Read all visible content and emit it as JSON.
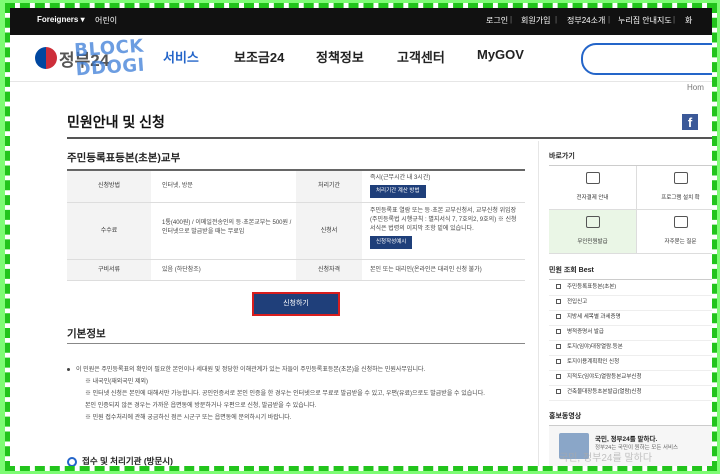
{
  "topbar": {
    "language": "Foreigners ▾",
    "accessibility": "어린이",
    "links": [
      "로그인",
      "회원가입",
      "정부24소개",
      "누리집 안내지도",
      "화"
    ]
  },
  "header": {
    "logo_text": "정부24",
    "logo_overlay": "BLOCK DDOGI",
    "nav": [
      "서비스",
      "보조금24",
      "정책정보",
      "고객센터",
      "MyGOV"
    ],
    "active_nav": "서비스",
    "home_link": "Hom"
  },
  "page": {
    "title": "민원안내 및 신청",
    "section_title": "주민등록표등본(초본)교부",
    "facebook_icon": "f"
  },
  "table": {
    "rows": [
      {
        "h1": "신청방법",
        "d1": "인터넷, 방문",
        "h2": "처리기간",
        "d2": "즉시(근무시간 내 3시간)",
        "d2_btn": "처리기간 계산 방법"
      },
      {
        "h1": "수수료",
        "d1": "1통(400원) / 이메일전송인의 등·초본교부는 500원 / 인터넷으로 발급받을 때는 무료임",
        "h2": "신청서",
        "d2": "주민등록표 열람 또는 등·초본 교부신청서, 교부신청 위임장 (주민등록법 시행규칙 : 별지서식 7, 7호의2, 9호의) ※ 신청서식은 법령의 이지막 조항 밑에 있습니다.",
        "d2_btn": "신청작성예시"
      },
      {
        "h1": "구비서류",
        "d1": "있음 (하단참조)",
        "h2": "신청자격",
        "d2": "본인 또는 대리인(온라인은 대리인 신청 불가)"
      }
    ]
  },
  "apply_button": "신청하기",
  "basic": {
    "title": "기본정보",
    "lines": [
      "이 민원은 주민등록표의 확인이 필요한 본인이나 세대원 및 정당한 이해관계가 있는 자들이 주민등록표등본(초본)을 신청하는 민원사무입니다.",
      "※ 내국인(재외국민 제외)",
      "※ 인터넷 신청은 본인에 대해서만 가능합니다. 공인인증서로 본인 인증을 한 경우는 인터넷으로 무료로 발급받을 수 있고, 우편(유료)으로도 발급받을 수 있습니다.",
      "본인 인증되지 않은 경우는 가까운 읍면동에 방문하거나 우편으로 신청, 발급받을 수 있습니다.",
      "※ 민원 접수처리에 관해 궁금하신 점은 시군구 또는 읍면동에 문의하시기 바랍니다."
    ],
    "reception": "접수 및 처리기관 (방문시)"
  },
  "sidebar": {
    "quick_title": "바로가기",
    "quick": [
      {
        "label": "전자결제 안내",
        "icon": "payment-icon"
      },
      {
        "label": "프로그램 설치 확",
        "icon": "program-icon"
      },
      {
        "label": "무인민원발급",
        "icon": "kiosk-icon"
      },
      {
        "label": "자주묻는 질문",
        "icon": "faq-icon"
      }
    ],
    "best_title": "민원 조회 Best",
    "best": [
      "주민등록표등본(초본)",
      "전입신고",
      "지방세 세목별 과세증명",
      "병적증명서 발급",
      "토지(임야)대장열람.등본",
      "토지이용계획확인 신청",
      "지적도(임야도)열람등본교부신청",
      "건축물대장등초본발급(열람)신청"
    ],
    "promo_title": "홍보동영상",
    "promo_headline": "국민, 정부24를 말하다.",
    "promo_sub": "정부24는 국민이 원하는 모든 서비스",
    "promo_watermark": "국민, 정부24를 말하다"
  },
  "colors": {
    "accent": "#2465c9",
    "button": "#1f3f7a",
    "highlight_border": "#d81e1e",
    "frame": "#22c41c"
  }
}
